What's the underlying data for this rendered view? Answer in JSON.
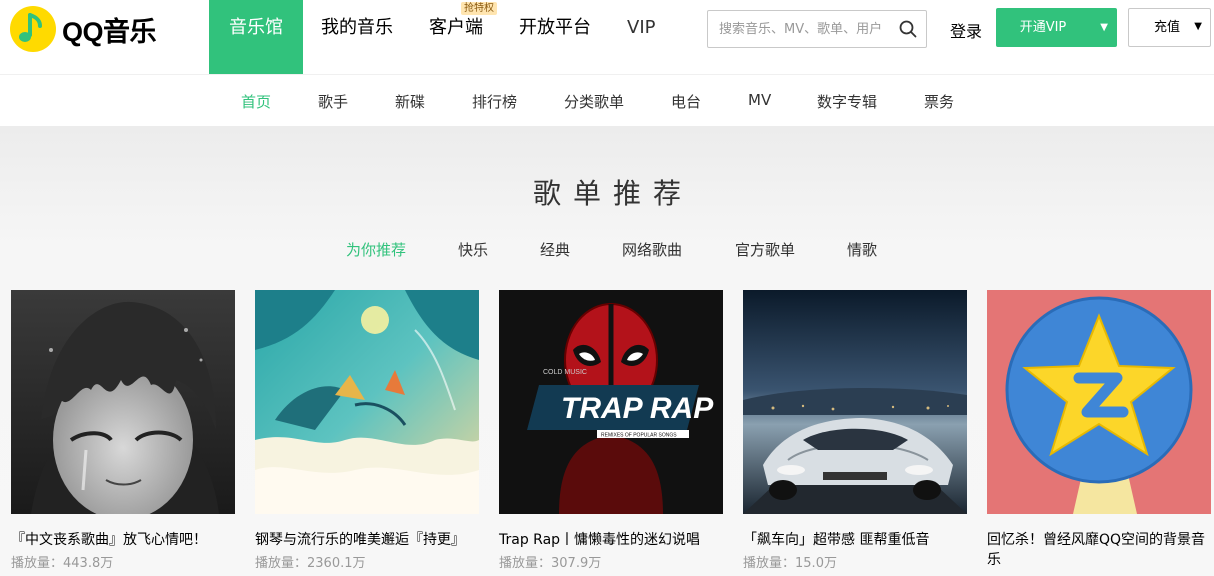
{
  "header": {
    "logo_text": "QQ音乐",
    "nav": [
      {
        "label": "音乐馆",
        "active": true
      },
      {
        "label": "我的音乐"
      },
      {
        "label": "客户端",
        "badge": "抢特权"
      },
      {
        "label": "开放平台"
      },
      {
        "label": "VIP"
      }
    ],
    "search_placeholder": "搜索音乐、MV、歌单、用户",
    "login_label": "登录",
    "vip_button_label": "开通VIP",
    "recharge_button_label": "充值"
  },
  "subnav": {
    "items": [
      "首页",
      "歌手",
      "新碟",
      "排行榜",
      "分类歌单",
      "电台",
      "MV",
      "数字专辑",
      "票务"
    ],
    "active_index": 0
  },
  "section": {
    "title": "歌单推荐",
    "tabs": [
      "为你推荐",
      "快乐",
      "经典",
      "网络歌曲",
      "官方歌单",
      "情歌"
    ],
    "active_tab": 0
  },
  "playlists": [
    {
      "title": "『中文丧系歌曲』放飞心情吧！",
      "play_label": "播放量：",
      "plays": "443.8万"
    },
    {
      "title": "钢琴与流行乐的唯美邂逅『持更』",
      "play_label": "播放量：",
      "plays": "2360.1万"
    },
    {
      "title": "Trap Rap丨慵懒毒性的迷幻说唱",
      "play_label": "播放量：",
      "plays": "307.9万",
      "cover_small_text": "COLD MUSIC",
      "cover_main_text": "TRAP RAP",
      "cover_sub_text": "REMIXES OF POPULAR SONGS"
    },
    {
      "title": "「飙车向」超带感 匪帮重低音",
      "play_label": "播放量：",
      "plays": "15.0万"
    },
    {
      "title": "回忆杀！曾经风靡QQ空间的背景音乐",
      "play_label": "",
      "plays": ""
    }
  ],
  "colors": {
    "accent": "#31c27c",
    "logo_yellow": "#ffda00"
  }
}
